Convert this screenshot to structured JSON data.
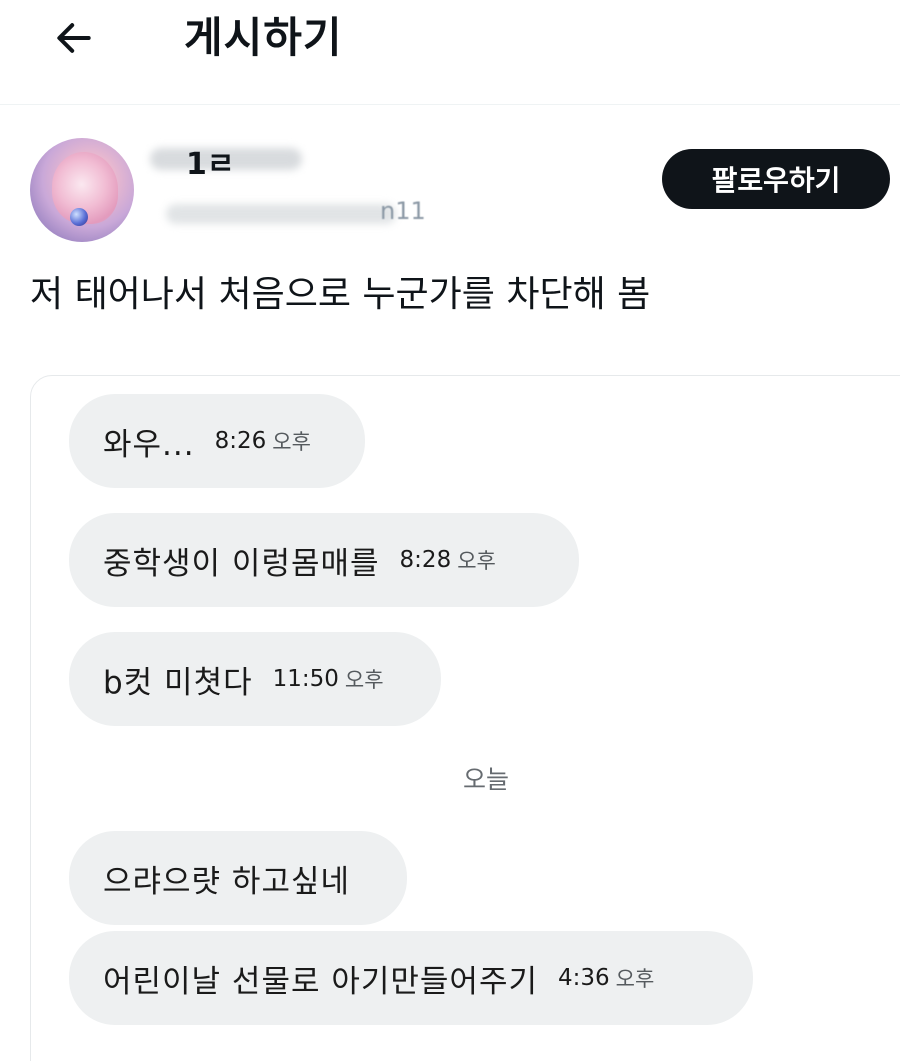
{
  "header": {
    "back_icon": "arrow-left-icon",
    "title": "게시하기"
  },
  "author": {
    "name_visible_part": "1ㄹ",
    "handle_visible_part": "n11",
    "follow_label": "팔로우하기"
  },
  "post": {
    "text": "저 태어나서 처음으로 누군가를 차단해 봄"
  },
  "chat": {
    "messages": [
      {
        "text": "와우...",
        "time": "8:26",
        "ampm": "오후"
      },
      {
        "text": "중학생이 이렁몸매를",
        "time": "8:28",
        "ampm": "오후"
      },
      {
        "text": "b컷 미쳣다",
        "time": "11:50",
        "ampm": "오후"
      },
      {
        "text": "으랴으럇 하고싶네",
        "time": "",
        "ampm": ""
      },
      {
        "text": "어린이날 선물로 아기만들어주기",
        "time": "4:36",
        "ampm": "오후"
      }
    ],
    "day_separator": "오늘"
  },
  "colors": {
    "follow_button_bg": "#0f1419",
    "bubble_bg": "#eef0f1",
    "divider": "#eff3f4"
  }
}
